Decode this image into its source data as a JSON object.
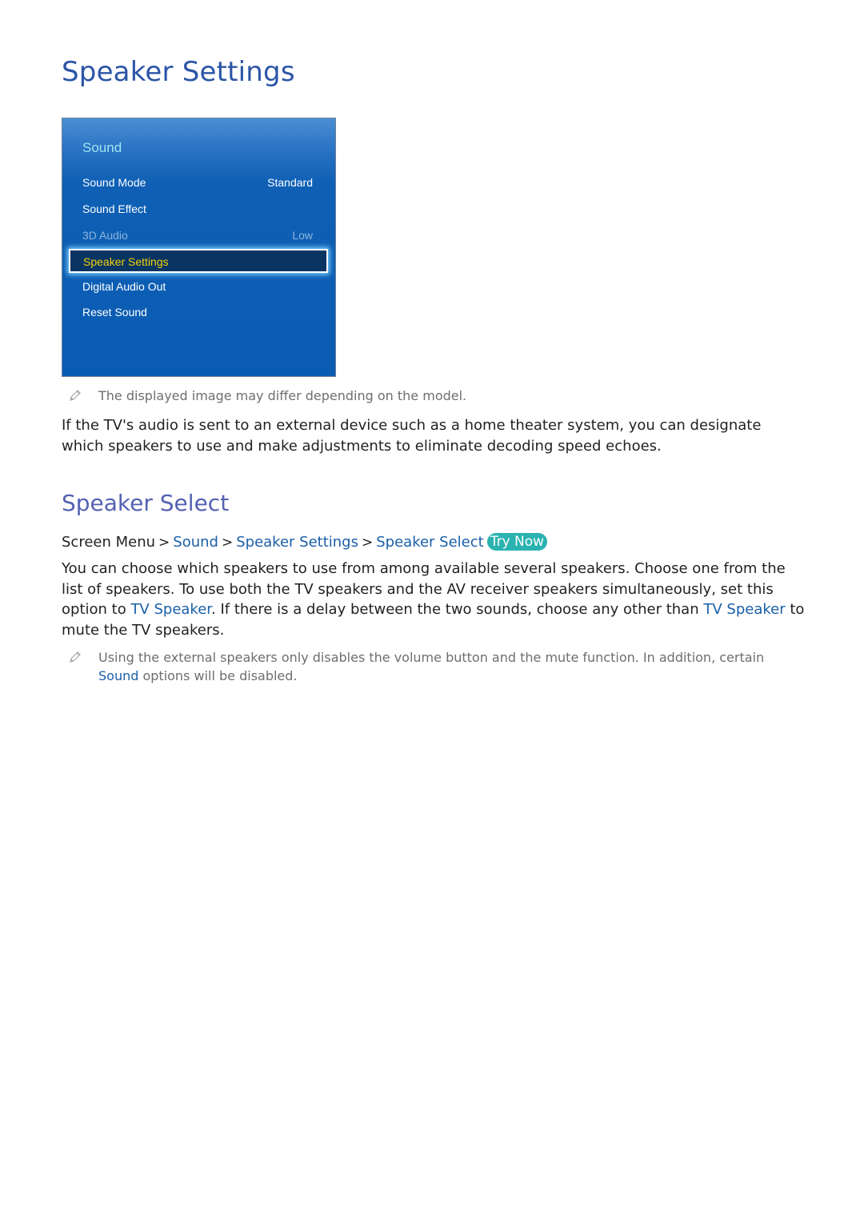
{
  "page": {
    "title": "Speaker Settings"
  },
  "tv_menu": {
    "title": "Sound",
    "items": [
      {
        "label": "Sound Mode",
        "value": "Standard",
        "state": "normal"
      },
      {
        "label": "Sound Effect",
        "value": "",
        "state": "normal"
      },
      {
        "label": "3D Audio",
        "value": "Low",
        "state": "disabled"
      },
      {
        "label": "Speaker Settings",
        "value": "",
        "state": "focused"
      },
      {
        "label": "Digital Audio Out",
        "value": "",
        "state": "normal"
      },
      {
        "label": "Reset Sound",
        "value": "",
        "state": "normal"
      }
    ],
    "colors": {
      "background": "#0a5cb3",
      "title": "#9ee6f2",
      "focused_text": "#f2d20b",
      "disabled_text": "#8fb4dc"
    }
  },
  "image_note": {
    "icon": "pencil-icon",
    "text": "The displayed image may differ depending on the model."
  },
  "intro": {
    "text": "If the TV's audio is sent to an external device such as a home theater system, you can designate which speakers to use and make adjustments to eliminate decoding speed echoes."
  },
  "section": {
    "title": "Speaker Select",
    "breadcrumb": {
      "root": "Screen Menu",
      "items": [
        "Sound",
        "Speaker Settings",
        "Speaker Select"
      ],
      "separator": ">",
      "try_now": "Try Now"
    },
    "body": {
      "part1": "You can choose which speakers to use from among available several speakers. Choose one from the list of speakers. To use both the TV speakers and the AV receiver speakers simultaneously, set this option to ",
      "link1": "TV Speaker",
      "part2": ". If there is a delay between the two sounds, choose any other than ",
      "link2": "TV Speaker",
      "part3": " to mute the TV speakers."
    },
    "note": {
      "icon": "pencil-icon",
      "text_part1": "Using the external speakers only disables the volume button and the mute function. In addition, certain",
      "link": "Sound",
      "text_part2": " options will be disabled."
    }
  },
  "colors": {
    "heading": "#2b55a6",
    "section_heading": "#5561b2",
    "link": "#1a5fa8",
    "try_now_badge": "#2ab3b0",
    "note_text": "#6d6e71"
  }
}
